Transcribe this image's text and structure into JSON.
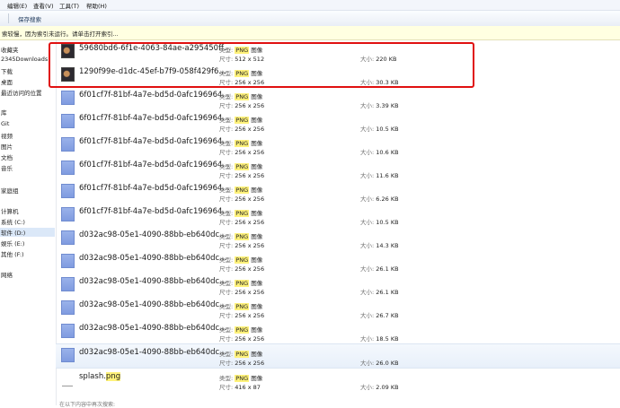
{
  "menu": [
    "编辑(E)",
    "查看(V)",
    "工具(T)",
    "帮助(H)"
  ],
  "toolbar": {
    "save_search": "保存搜索"
  },
  "infobar": {
    "text": "索较慢，因为索引未运行。请单击打开索引..."
  },
  "nav": [
    {
      "label": "收藏夹",
      "selected": false
    },
    {
      "label": "2345Downloads",
      "selected": false
    },
    {
      "label": "下载",
      "selected": false
    },
    {
      "label": "桌面",
      "selected": false
    },
    {
      "label": "最近访问的位置",
      "selected": false
    },
    {
      "label": "库",
      "selected": false
    },
    {
      "label": "Git",
      "selected": false
    },
    {
      "label": "视频",
      "selected": false
    },
    {
      "label": "图片",
      "selected": false
    },
    {
      "label": "文档",
      "selected": false
    },
    {
      "label": "音乐",
      "selected": false
    },
    {
      "label": "家庭组",
      "selected": false
    },
    {
      "label": "计算机",
      "selected": false
    },
    {
      "label": "系统 (C:)",
      "selected": false
    },
    {
      "label": "软件 (D:)",
      "selected": true
    },
    {
      "label": "娱乐 (E:)",
      "selected": false
    },
    {
      "label": "其他 (F:)",
      "selected": false
    },
    {
      "label": "网络",
      "selected": false
    }
  ],
  "labels": {
    "type": "类型:",
    "dims": "尺寸:",
    "size": "大小:",
    "png": "PNG",
    "image": "图像"
  },
  "files": [
    {
      "name": "59680bd6-6f1e-4063-84ae-a295450ff...",
      "dims": "512 x 512",
      "size": "220 KB",
      "thumb": "photo"
    },
    {
      "name": "1290f99e-d1dc-45ef-b7f9-058f429f6...",
      "dims": "256 x 256",
      "size": "30.3 KB",
      "thumb": "photo"
    },
    {
      "name": "6f01cf7f-81bf-4a7e-bd5d-0afc196964...",
      "dims": "256 x 256",
      "size": "3.39 KB",
      "thumb": "blue"
    },
    {
      "name": "6f01cf7f-81bf-4a7e-bd5d-0afc196964...",
      "dims": "256 x 256",
      "size": "10.5 KB",
      "thumb": "blue"
    },
    {
      "name": "6f01cf7f-81bf-4a7e-bd5d-0afc196964...",
      "dims": "256 x 256",
      "size": "10.6 KB",
      "thumb": "blue"
    },
    {
      "name": "6f01cf7f-81bf-4a7e-bd5d-0afc196964...",
      "dims": "256 x 256",
      "size": "11.6 KB",
      "thumb": "blue"
    },
    {
      "name": "6f01cf7f-81bf-4a7e-bd5d-0afc196964...",
      "dims": "256 x 256",
      "size": "6.26 KB",
      "thumb": "blue"
    },
    {
      "name": "6f01cf7f-81bf-4a7e-bd5d-0afc196964...",
      "dims": "256 x 256",
      "size": "10.5 KB",
      "thumb": "blue"
    },
    {
      "name": "d032ac98-05e1-4090-88bb-eb640dc...",
      "dims": "256 x 256",
      "size": "14.3 KB",
      "thumb": "blue"
    },
    {
      "name": "d032ac98-05e1-4090-88bb-eb640dc...",
      "dims": "256 x 256",
      "size": "26.1 KB",
      "thumb": "blue"
    },
    {
      "name": "d032ac98-05e1-4090-88bb-eb640dc...",
      "dims": "256 x 256",
      "size": "26.1 KB",
      "thumb": "blue"
    },
    {
      "name": "d032ac98-05e1-4090-88bb-eb640dc...",
      "dims": "256 x 256",
      "size": "26.7 KB",
      "thumb": "blue"
    },
    {
      "name": "d032ac98-05e1-4090-88bb-eb640dc...",
      "dims": "256 x 256",
      "size": "18.5 KB",
      "thumb": "blue"
    },
    {
      "name": "d032ac98-05e1-4090-88bb-eb640dc...",
      "dims": "256 x 256",
      "size": "26.0 KB",
      "thumb": "blue",
      "highlighted": true
    },
    {
      "name_prefix": "splash.",
      "name_highlight": "png",
      "dims": "416 x 87",
      "size": "2.09 KB",
      "thumb": "splash"
    }
  ],
  "footer": "在以下内容中再次搜索:",
  "colors": {
    "annotation_box": "#e01010",
    "match_highlight": "#fff27a",
    "selected_nav": "#dbe8f8"
  }
}
